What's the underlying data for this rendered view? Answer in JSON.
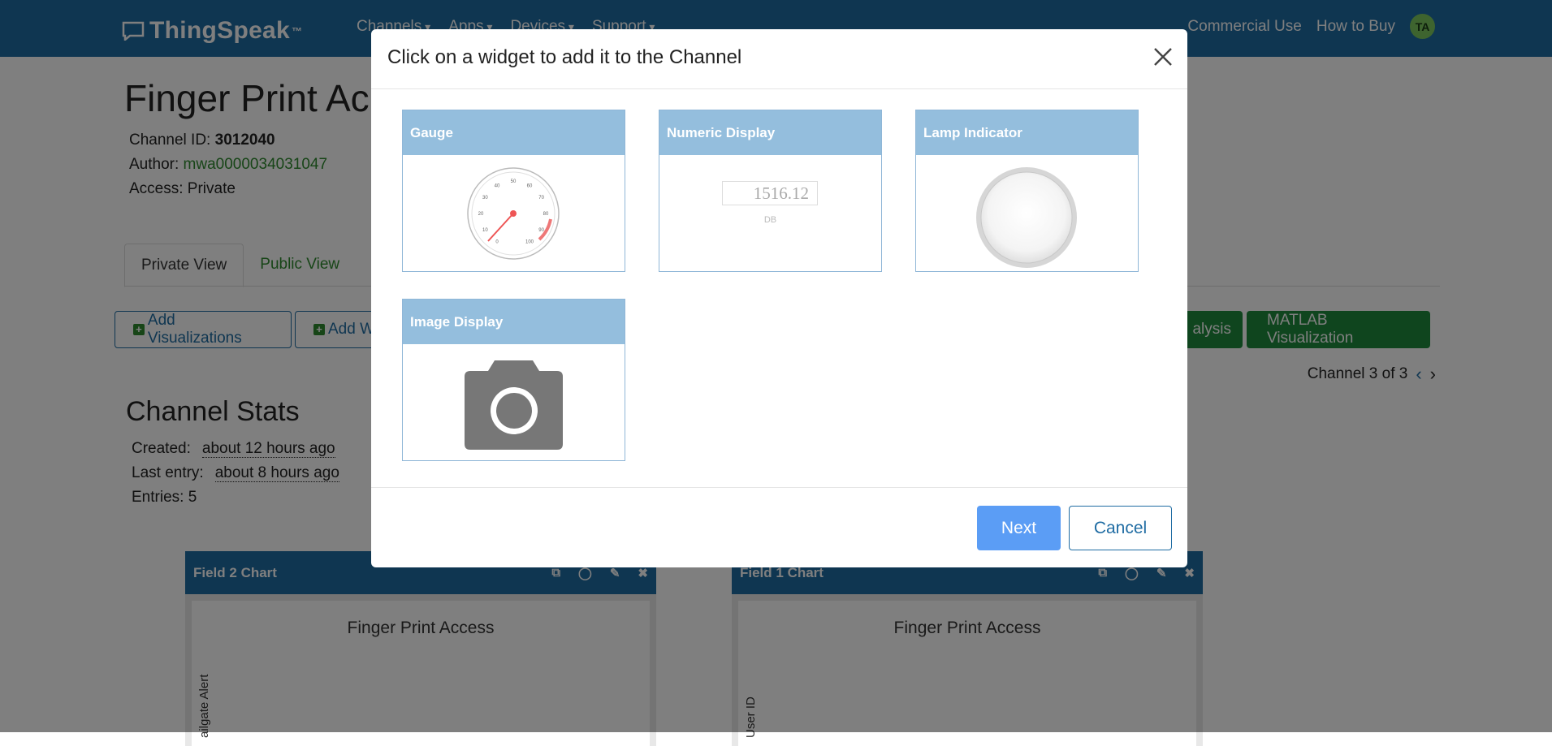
{
  "navbar": {
    "logo_text": "ThingSpeak",
    "logo_tm": "™",
    "menu": [
      "Channels",
      "Apps",
      "Devices",
      "Support"
    ],
    "links": [
      "Commercial Use",
      "How to Buy"
    ],
    "avatar_initials": "TA"
  },
  "channel": {
    "title": "Finger Print Ac",
    "id_label": "Channel ID: ",
    "id_value": "3012040",
    "author_label": "Author: ",
    "author_value": "mwa0000034031047",
    "access": "Access: Private"
  },
  "tabs": {
    "private": "Private View",
    "public": "Public View"
  },
  "toolbar": {
    "add_visualizations": "Add Visualizations",
    "add_widgets": "Add W",
    "analysis": "alysis",
    "matlab_visualization": "MATLAB Visualization"
  },
  "channel_nav": {
    "text": "Channel 3 of 3"
  },
  "stats": {
    "title": "Channel Stats",
    "created_label": "Created:",
    "created_value": "about 12 hours ago",
    "last_entry_label": "Last entry:",
    "last_entry_value": "about 8 hours ago",
    "entries": "Entries: 5"
  },
  "panels": [
    {
      "title": "Field 2 Chart",
      "chart_title": "Finger Print Access",
      "ylabel": "ailgate Alert"
    },
    {
      "title": "Field 1 Chart",
      "chart_title": "Finger Print Access",
      "ylabel": "User ID"
    }
  ],
  "modal": {
    "title": "Click on a widget to add it to the Channel",
    "next": "Next",
    "cancel": "Cancel",
    "widgets": {
      "gauge": "Gauge",
      "numeric": "Numeric Display",
      "lamp": "Lamp Indicator",
      "image": "Image Display"
    },
    "numeric_value": "1516.12",
    "numeric_unit": "DB",
    "gauge_ticks": [
      "0",
      "10",
      "20",
      "30",
      "40",
      "50",
      "60",
      "70",
      "80",
      "90",
      "100"
    ]
  },
  "colors": {
    "navbar": "#1f6ca3",
    "accent_green": "#1f8a3c",
    "widget_header": "#94bedd",
    "next_button": "#5b9df5"
  }
}
